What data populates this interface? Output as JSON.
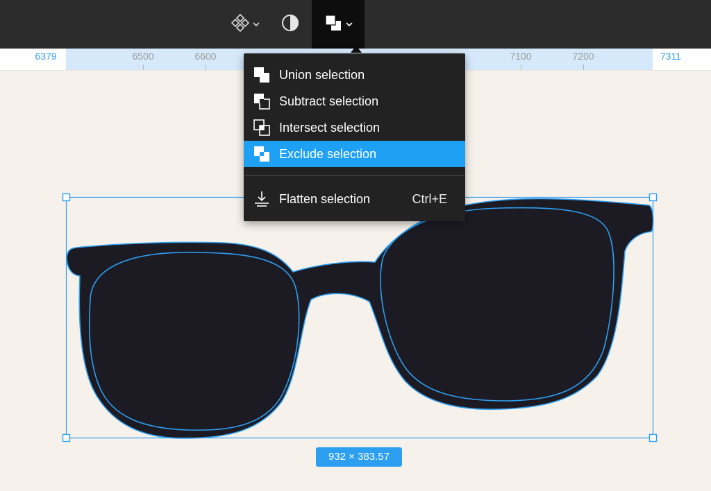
{
  "toolbar": {
    "components_icon": "components-diamond-icon",
    "contrast_icon": "half-circle-contrast-icon",
    "boolean_icon": "boolean-union-icon",
    "chevron_icon": "chevron-down-icon"
  },
  "ruler": {
    "labels": [
      "6379",
      "6500",
      "6600",
      "7100",
      "7200",
      "7311"
    ],
    "selection_color": "#d5e9fb",
    "edge_label_color": "#3aa1f0"
  },
  "menu": {
    "items": [
      {
        "label": "Union selection",
        "icon": "union-selection-icon",
        "active": false
      },
      {
        "label": "Subtract selection",
        "icon": "subtract-selection-icon",
        "active": false
      },
      {
        "label": "Intersect selection",
        "icon": "intersect-selection-icon",
        "active": false
      },
      {
        "label": "Exclude selection",
        "icon": "exclude-selection-icon",
        "active": true
      }
    ],
    "flatten": {
      "label": "Flatten selection",
      "shortcut": "Ctrl+E",
      "icon": "flatten-icon"
    },
    "active_color": "#1ea0f5"
  },
  "canvas": {
    "object": "sunglasses",
    "size_label": "932 × 383.57",
    "selection_color": "#2d9ff0",
    "fill_color": "#1c1b24"
  }
}
